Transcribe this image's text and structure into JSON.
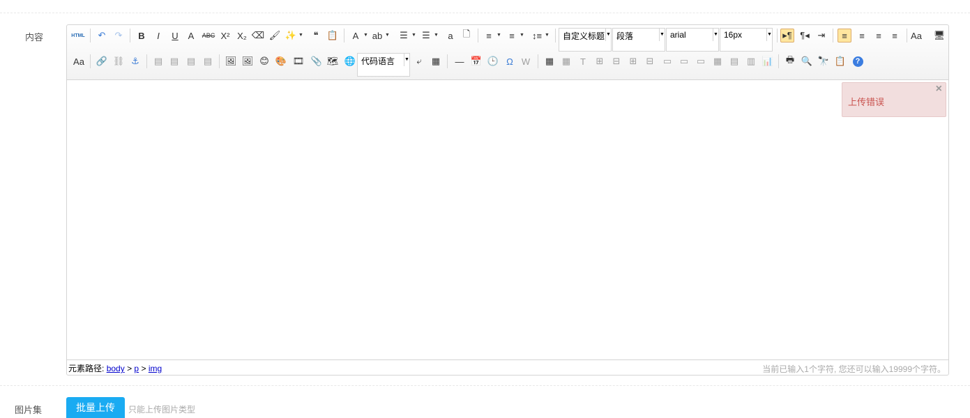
{
  "form": {
    "content_label": "内容",
    "gallery_label": "图片集",
    "upload_button": "批量上传",
    "upload_hint": "只能上传图片类型"
  },
  "toolbar": {
    "row1": [
      {
        "key": "source",
        "name": "html-source-icon",
        "glyph": "HTML"
      },
      {
        "key": "undo",
        "name": "undo-icon",
        "glyph": "↶"
      },
      {
        "key": "redo",
        "name": "redo-icon",
        "glyph": "↷",
        "disabled": true
      },
      {
        "key": "bold",
        "name": "bold-icon",
        "glyph": "B"
      },
      {
        "key": "italic",
        "name": "italic-icon",
        "glyph": "I"
      },
      {
        "key": "underline",
        "name": "underline-icon",
        "glyph": "U"
      },
      {
        "key": "fontborder",
        "name": "font-border-icon",
        "glyph": "A"
      },
      {
        "key": "strike",
        "name": "strikethrough-icon",
        "glyph": "ABC"
      },
      {
        "key": "sup",
        "name": "superscript-icon",
        "glyph": "X²"
      },
      {
        "key": "sub",
        "name": "subscript-icon",
        "glyph": "X₂"
      },
      {
        "key": "eraser",
        "name": "eraser-icon",
        "glyph": "⌫"
      },
      {
        "key": "brush",
        "name": "format-brush-icon",
        "glyph": "🖌"
      },
      {
        "key": "autotype",
        "name": "magic-wand-icon",
        "glyph": "✨",
        "arrow": true
      },
      {
        "key": "quote",
        "name": "blockquote-icon",
        "glyph": "❝"
      },
      {
        "key": "pastetext",
        "name": "paste-text-icon",
        "glyph": "📋"
      },
      {
        "key": "forecolor",
        "name": "font-color-icon",
        "glyph": "A",
        "arrow": true
      },
      {
        "key": "backcolor",
        "name": "highlight-icon",
        "glyph": "ab",
        "arrow": true
      },
      {
        "key": "ol",
        "name": "ordered-list-icon",
        "glyph": "☰",
        "arrow": true
      },
      {
        "key": "ul",
        "name": "unordered-list-icon",
        "glyph": "☰",
        "arrow": true
      },
      {
        "key": "selectall",
        "name": "select-all-icon",
        "glyph": "a"
      },
      {
        "key": "cleardoc",
        "name": "clear-doc-icon",
        "glyph": "🗋"
      },
      {
        "key": "rowtop",
        "name": "row-spacing-top-icon",
        "glyph": "≡",
        "arrow": true
      },
      {
        "key": "rowbottom",
        "name": "row-spacing-bottom-icon",
        "glyph": "≡",
        "arrow": true
      },
      {
        "key": "lineheight",
        "name": "line-height-icon",
        "glyph": "↕≡",
        "arrow": true
      },
      {
        "key": "ltr",
        "name": "direction-ltr-icon",
        "glyph": "▸¶",
        "active": true
      },
      {
        "key": "rtl",
        "name": "direction-rtl-icon",
        "glyph": "¶◂"
      },
      {
        "key": "indent",
        "name": "indent-icon",
        "glyph": "⇥"
      },
      {
        "key": "left",
        "name": "justify-left-icon",
        "glyph": "≡",
        "active": true
      },
      {
        "key": "center",
        "name": "justify-center-icon",
        "glyph": "≡"
      },
      {
        "key": "right",
        "name": "justify-right-icon",
        "glyph": "≡"
      },
      {
        "key": "justify",
        "name": "justify-full-icon",
        "glyph": "≡"
      },
      {
        "key": "touppercase",
        "name": "to-uppercase-icon",
        "glyph": "Aa"
      },
      {
        "key": "fullscreen",
        "name": "fullscreen-icon",
        "glyph": "🖥"
      }
    ],
    "row2": [
      {
        "key": "tolower",
        "name": "to-lowercase-icon",
        "glyph": "Aa"
      },
      {
        "key": "link",
        "name": "link-icon",
        "glyph": "🔗"
      },
      {
        "key": "unlink",
        "name": "unlink-icon",
        "glyph": "⛓",
        "disabled": true
      },
      {
        "key": "anchor",
        "name": "anchor-icon",
        "glyph": "⚓"
      },
      {
        "key": "imgnone",
        "name": "image-none-icon",
        "glyph": "▤",
        "disabled": true
      },
      {
        "key": "imgleft",
        "name": "image-left-icon",
        "glyph": "▤",
        "disabled": true
      },
      {
        "key": "imgright",
        "name": "image-right-icon",
        "glyph": "▤",
        "disabled": true
      },
      {
        "key": "imgcenter",
        "name": "image-center-icon",
        "glyph": "▤",
        "disabled": true
      },
      {
        "key": "image",
        "name": "insert-image-icon",
        "glyph": "🖼"
      },
      {
        "key": "multiimage",
        "name": "multi-image-icon",
        "glyph": "🖼"
      },
      {
        "key": "emotion",
        "name": "emoticon-icon",
        "glyph": "😊"
      },
      {
        "key": "scrawl",
        "name": "scrawl-icon",
        "glyph": "🎨"
      },
      {
        "key": "video",
        "name": "video-icon",
        "glyph": "🎞"
      },
      {
        "key": "attachment",
        "name": "attachment-icon",
        "glyph": "📎"
      },
      {
        "key": "map",
        "name": "map-icon",
        "glyph": "🗺"
      },
      {
        "key": "gmap",
        "name": "google-map-icon",
        "glyph": "🌐"
      },
      {
        "key": "pagebreak",
        "name": "page-break-icon",
        "glyph": "⤶"
      },
      {
        "key": "template",
        "name": "template-icon",
        "glyph": "▦"
      },
      {
        "key": "hr",
        "name": "horizontal-rule-icon",
        "glyph": "—"
      },
      {
        "key": "date",
        "name": "calendar-icon",
        "glyph": "📅"
      },
      {
        "key": "time",
        "name": "clock-icon",
        "glyph": "🕒"
      },
      {
        "key": "spechars",
        "name": "special-chars-icon",
        "glyph": "Ω"
      },
      {
        "key": "wordimage",
        "name": "word-image-icon",
        "glyph": "W",
        "disabled": true
      },
      {
        "key": "table",
        "name": "insert-table-icon",
        "glyph": "▦"
      },
      {
        "key": "deltable",
        "name": "delete-table-icon",
        "glyph": "▦",
        "disabled": true
      },
      {
        "key": "caption",
        "name": "table-caption-icon",
        "glyph": "T",
        "disabled": true
      },
      {
        "key": "insertrow",
        "name": "insert-row-icon",
        "glyph": "⊞",
        "disabled": true
      },
      {
        "key": "deleterow",
        "name": "delete-row-icon",
        "glyph": "⊟",
        "disabled": true
      },
      {
        "key": "insertcol",
        "name": "insert-col-icon",
        "glyph": "⊞",
        "disabled": true
      },
      {
        "key": "deletecol",
        "name": "delete-col-icon",
        "glyph": "⊟",
        "disabled": true
      },
      {
        "key": "mergecells",
        "name": "merge-cells-icon",
        "glyph": "▭",
        "disabled": true
      },
      {
        "key": "mergeright",
        "name": "merge-right-icon",
        "glyph": "▭",
        "disabled": true
      },
      {
        "key": "mergedown",
        "name": "merge-down-icon",
        "glyph": "▭",
        "disabled": true
      },
      {
        "key": "splitcells",
        "name": "split-cells-icon",
        "glyph": "▦",
        "disabled": true
      },
      {
        "key": "splitrows",
        "name": "split-rows-icon",
        "glyph": "▤",
        "disabled": true
      },
      {
        "key": "splitcols",
        "name": "split-cols-icon",
        "glyph": "▥",
        "disabled": true
      },
      {
        "key": "charts",
        "name": "charts-icon",
        "glyph": "📊",
        "disabled": true
      },
      {
        "key": "print",
        "name": "print-icon",
        "glyph": "🖶"
      },
      {
        "key": "preview",
        "name": "preview-icon",
        "glyph": "🔍"
      },
      {
        "key": "search",
        "name": "search-replace-icon",
        "glyph": "🔭"
      },
      {
        "key": "drafts",
        "name": "drafts-icon",
        "glyph": "📋"
      },
      {
        "key": "help",
        "name": "help-icon",
        "glyph": "?"
      }
    ],
    "title_select": "自定义标题",
    "paragraph_select": "段落",
    "font_family": "arial",
    "font_size": "16px",
    "code_language": "代码语言"
  },
  "footer": {
    "path_label": "元素路径:",
    "path": [
      "body",
      "p",
      "img"
    ],
    "separator": ">",
    "wordcount": "当前已输入1个字符, 您还可以输入19999个字符。"
  },
  "toast": {
    "message": "上传错误",
    "close": "×"
  }
}
